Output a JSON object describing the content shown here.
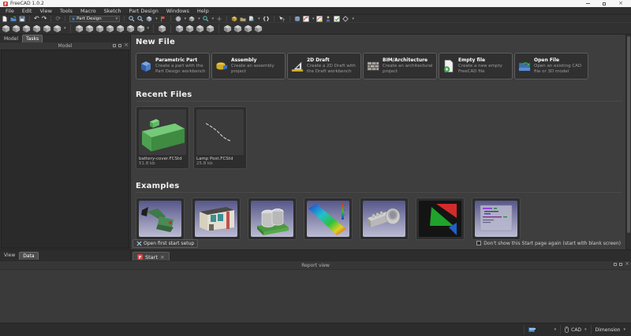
{
  "window": {
    "title": "FreeCAD 1.0.2",
    "controls": [
      "minimize-icon",
      "maximize-icon",
      "close-icon"
    ]
  },
  "menubar": [
    "File",
    "Edit",
    "View",
    "Tools",
    "Macro",
    "Sketch",
    "Part Design",
    "Windows",
    "Help"
  ],
  "toolbar": {
    "workbench_selector": "Part Design",
    "row1_icons": [
      "new-file",
      "open-file",
      "save",
      "undo",
      "redo",
      "refresh",
      "zoom-in",
      "zoom-out",
      "isometric-view",
      "paint-view",
      "draw-style",
      "view-cube",
      "selection-view",
      "axis-cross",
      "part",
      "group-folder",
      "export",
      "expression-braces",
      "whats-this",
      "create-body",
      "create-sketch",
      "edit-sketch",
      "map-sketch",
      "validate-sketch",
      "create-datum"
    ],
    "row2_icon_name": "part-design-tool",
    "row2_groups": [
      6,
      7,
      1,
      4,
      4
    ]
  },
  "combo_view": {
    "tabs": [
      "Model",
      "Tasks"
    ],
    "active_tab": "Tasks",
    "dock_title": "Model",
    "property_tabs": [
      "View",
      "Data"
    ],
    "active_property_tab": "Data"
  },
  "start_page": {
    "headings": {
      "new_file": "New File",
      "recent_files": "Recent Files",
      "examples": "Examples"
    },
    "new_file_cards": [
      {
        "title": "Parametric Part",
        "description": "Create a part with the Part Design workbench",
        "icon": "parametric-part-icon"
      },
      {
        "title": "Assembly",
        "description": "Create an assembly project",
        "icon": "assembly-icon"
      },
      {
        "title": "2D Draft",
        "description": "Create a 2D Draft with the Draft workbench",
        "icon": "draft-icon"
      },
      {
        "title": "BIM/Architecture",
        "description": "Create an architectural project",
        "icon": "bim-icon"
      },
      {
        "title": "Empty file",
        "description": "Create a new empty FreeCAD file",
        "icon": "empty-file-icon"
      },
      {
        "title": "Open File",
        "description": "Open an existing CAD file or 3D model",
        "icon": "open-file-icon"
      }
    ],
    "recent_files": [
      {
        "name": "battery-cover.FCStd",
        "size": "51.8 kb",
        "thumbnail": "green-part-thumbnail"
      },
      {
        "name": "Lamp Post.FCStd",
        "size": "25.8 kb",
        "thumbnail": "curve-sketch-thumbnail"
      }
    ],
    "examples": [
      "excavator",
      "house",
      "pump",
      "fem-beam",
      "clamp",
      "color-triangles",
      "macro-code"
    ],
    "footer": {
      "open_first_start_button": "Open first start setup",
      "dont_show_checkbox_label": "Don't show this Start page again (start with blank screen)",
      "dont_show_checked": false
    }
  },
  "mdi_tabs": [
    {
      "label": "Start",
      "closable": true
    }
  ],
  "report_view": {
    "title": "Report view"
  },
  "status_bar": {
    "navigation_style": "CAD",
    "dimension_label": "Dimension"
  },
  "colors": {
    "titlebar_bg": "#f5f5f5",
    "ui_bg": "#313131",
    "panel_bg": "#2a2a2a",
    "start_bg": "#3e3e3e",
    "accent_blue": "#5b9bd5",
    "freecad_red": "#d9403d",
    "example_gradient_top": "#57578a",
    "example_gradient_bottom": "#bcbcd4"
  }
}
